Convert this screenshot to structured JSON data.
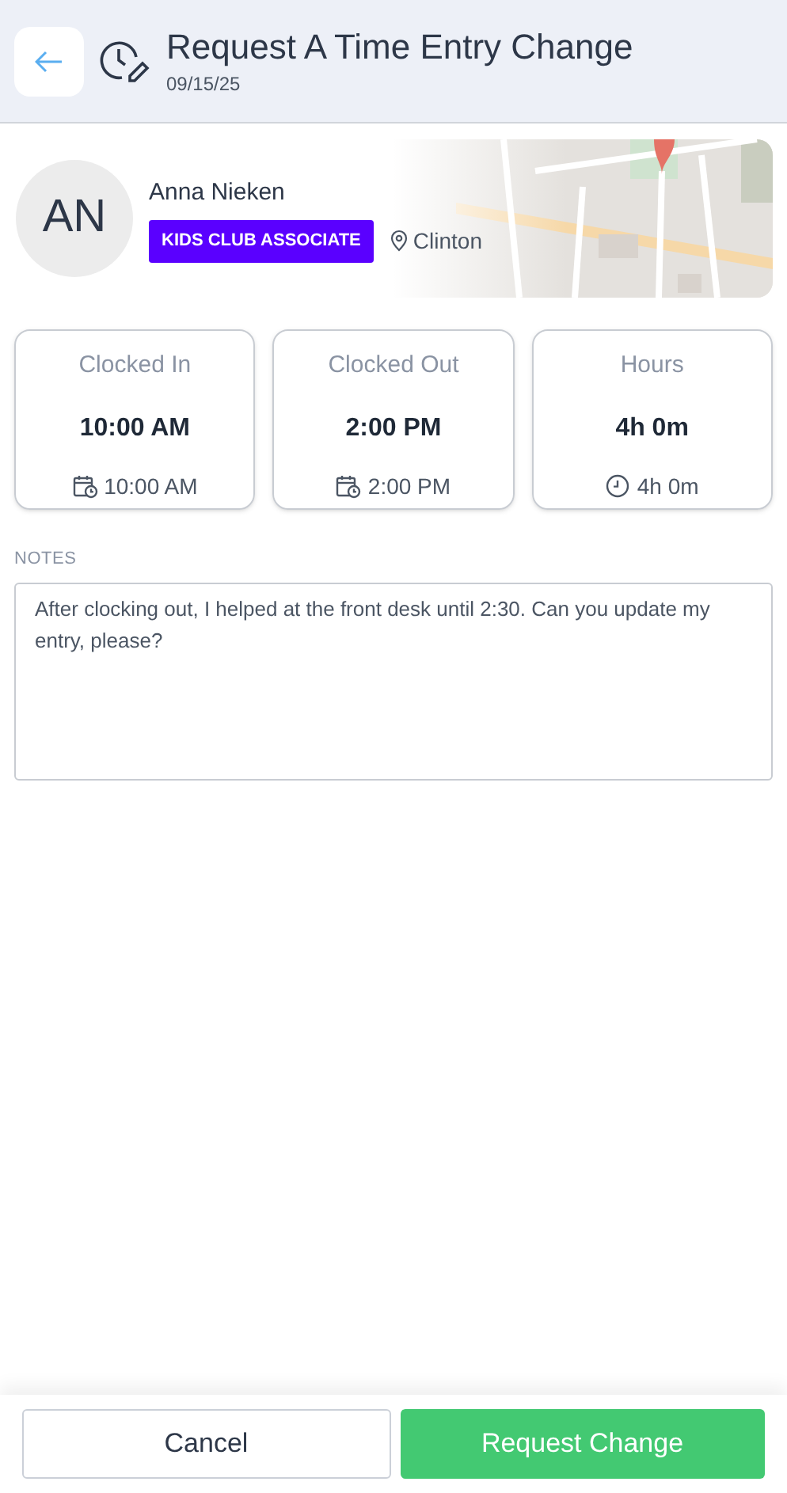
{
  "header": {
    "title": "Request A Time Entry Change",
    "date": "09/15/25"
  },
  "employee": {
    "initials": "AN",
    "name": "Anna Nieken",
    "role": "KIDS CLUB ASSOCIATE",
    "location": "Clinton"
  },
  "stats": [
    {
      "label": "Clocked In",
      "value": "10:00 AM",
      "kind": "calendar",
      "detail": "10:00 AM"
    },
    {
      "label": "Clocked Out",
      "value": "2:00 PM",
      "kind": "calendar",
      "detail": "2:00 PM"
    },
    {
      "label": "Hours",
      "value": "4h 0m",
      "kind": "clock",
      "detail": "4h 0m"
    }
  ],
  "notes": {
    "label": "NOTES",
    "value": "After clocking out, I helped at the front desk until 2:30. Can you update my entry, please?"
  },
  "buttons": {
    "cancel": "Cancel",
    "submit": "Request Change"
  }
}
